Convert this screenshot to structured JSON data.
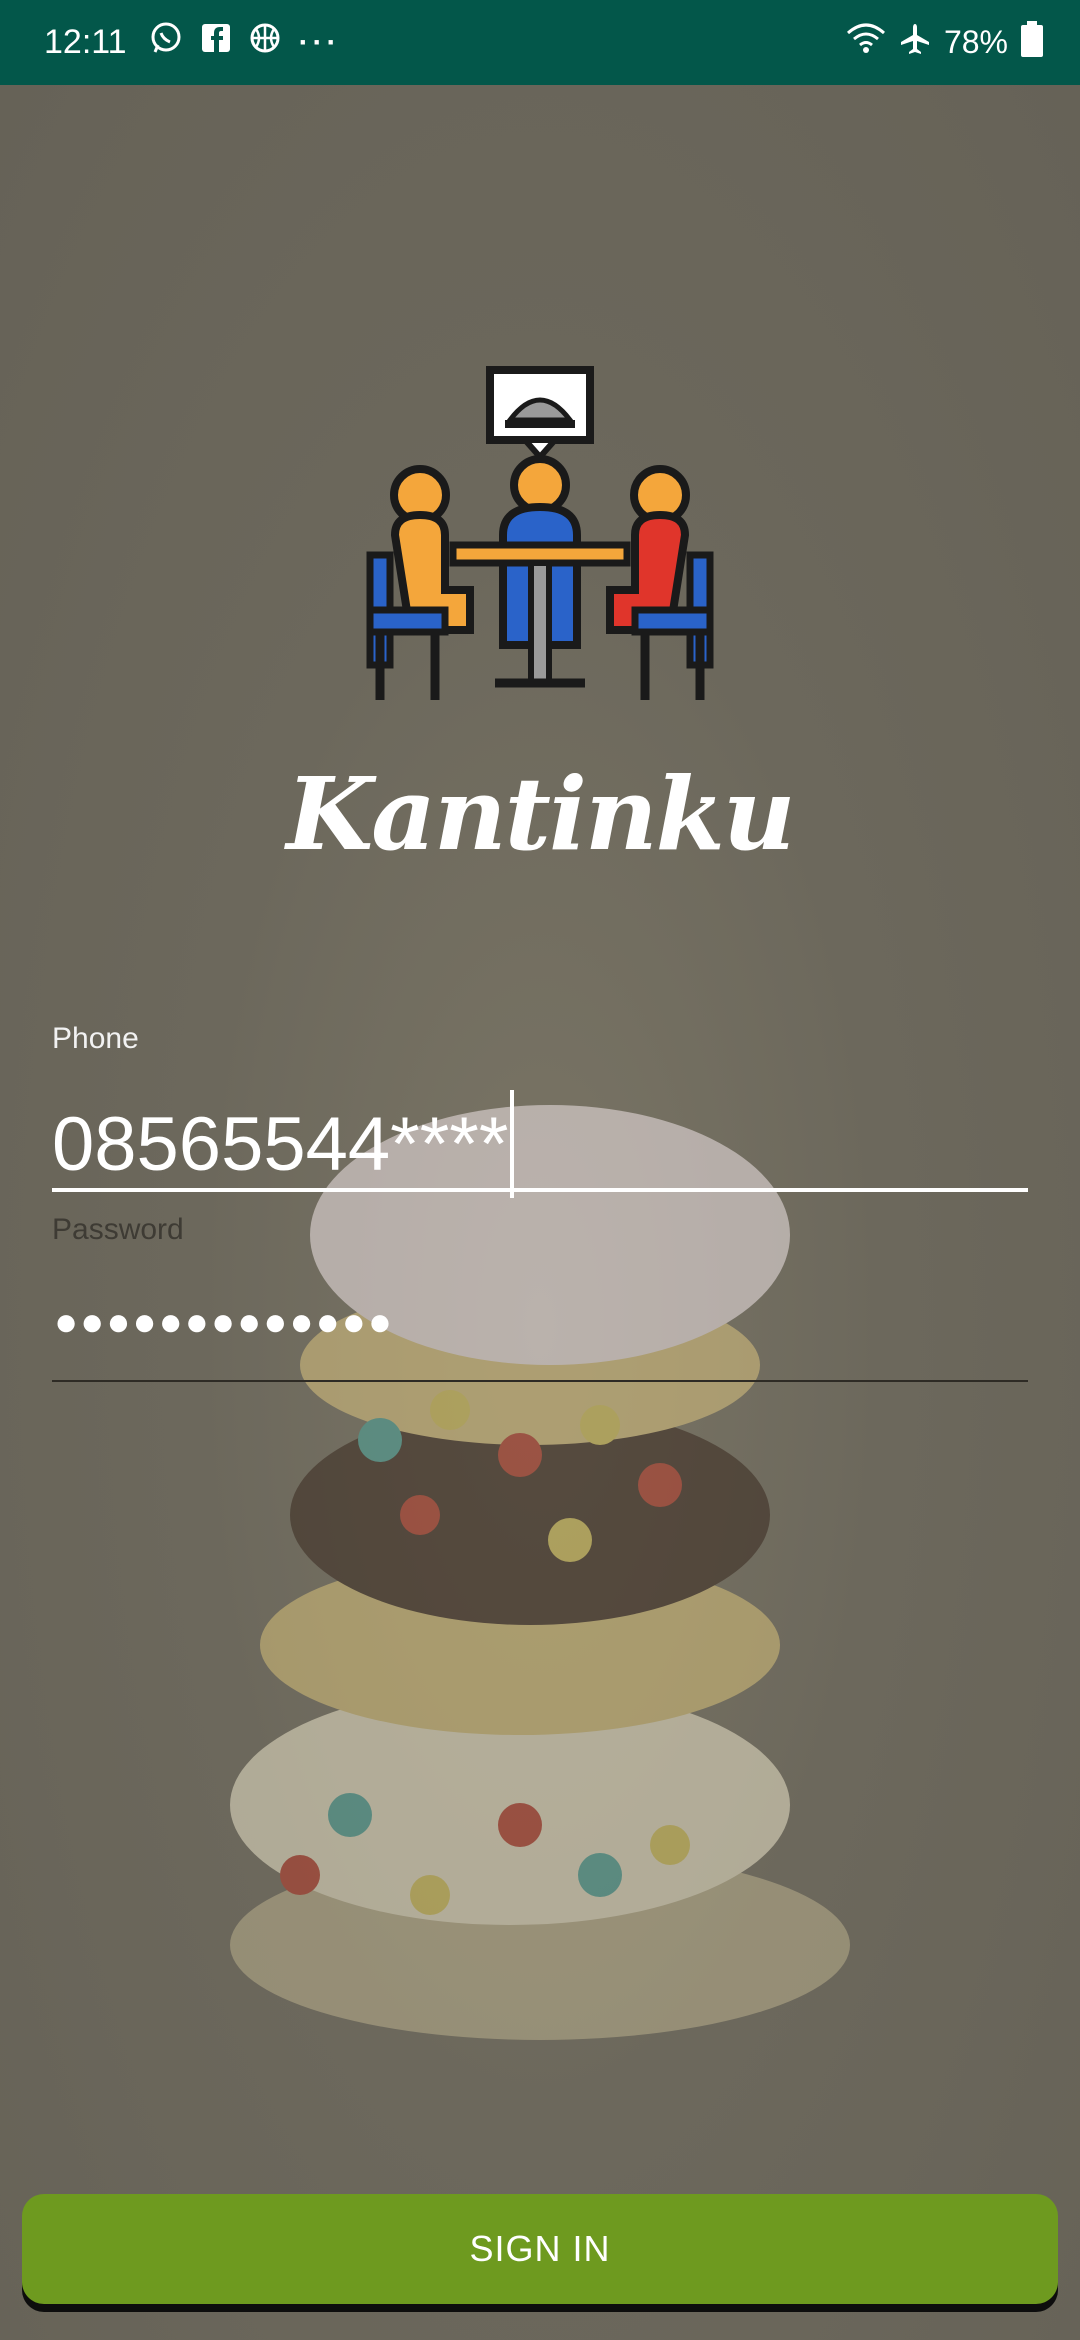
{
  "status_bar": {
    "time": "12:11",
    "battery": "78%",
    "icons_left": [
      "whatsapp-icon",
      "facebook-icon",
      "basketball-icon",
      "more-dots-icon"
    ],
    "icons_right": [
      "wifi-icon",
      "airplane-mode-icon",
      "battery-icon"
    ],
    "more": "···"
  },
  "app": {
    "name": "Kantinku",
    "logo": "canteen-people-table-icon"
  },
  "form": {
    "phone_label": "Phone",
    "phone_value": "08565544****",
    "password_label": "Password",
    "password_value": "●●●●●●●●●●●●●"
  },
  "actions": {
    "sign_in_label": "SIGN IN"
  },
  "colors": {
    "status_bar": "#03574a",
    "button": "#6e9a1f",
    "background_overlay": "#6b675c"
  }
}
